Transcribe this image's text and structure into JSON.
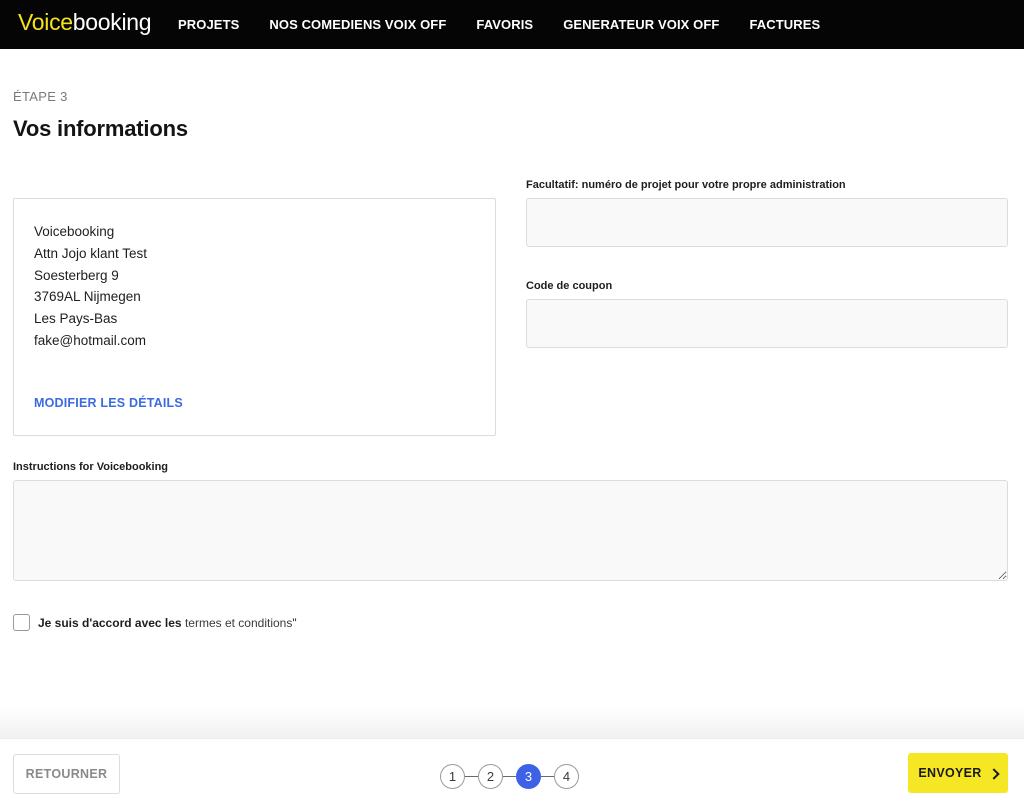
{
  "brand": {
    "part1": "Voice",
    "part2": "booking"
  },
  "nav": {
    "items": [
      {
        "label": "PROJETS"
      },
      {
        "label": "NOS COMEDIENS VOIX OFF"
      },
      {
        "label": "FAVORIS"
      },
      {
        "label": "GENERATEUR VOIX OFF"
      },
      {
        "label": "FACTURES"
      }
    ]
  },
  "header": {
    "step_label": "ÉTAPE 3",
    "title": "Vos informations"
  },
  "address": {
    "lines": [
      "Voicebooking",
      "Attn Jojo klant Test",
      "Soesterberg 9",
      "3769AL Nijmegen",
      "Les Pays-Bas",
      "fake@hotmail.com"
    ],
    "edit_label": "MODIFIER LES DÉTAILS"
  },
  "fields": {
    "project_number": {
      "label": "Facultatif: numéro de projet pour votre propre administration",
      "value": "",
      "placeholder": ""
    },
    "coupon": {
      "label": "Code de coupon",
      "value": "",
      "placeholder": ""
    },
    "instructions": {
      "label": "Instructions for Voicebooking",
      "value": "",
      "placeholder": ""
    }
  },
  "terms": {
    "text": "Je suis d'accord avec les ",
    "link": "termes et conditions",
    "suffix": "\"",
    "checked": false
  },
  "footer": {
    "back_label": "RETOURNER",
    "steps": [
      "1",
      "2",
      "3",
      "4"
    ],
    "active_step": 3,
    "send_label": "ENVOYER"
  },
  "colors": {
    "accent_yellow": "#f5e724",
    "link_blue": "#3c6be0",
    "step_active": "#3d62e6",
    "topbar": "#050505"
  },
  "icons": {
    "send": "chevron-right-icon"
  }
}
